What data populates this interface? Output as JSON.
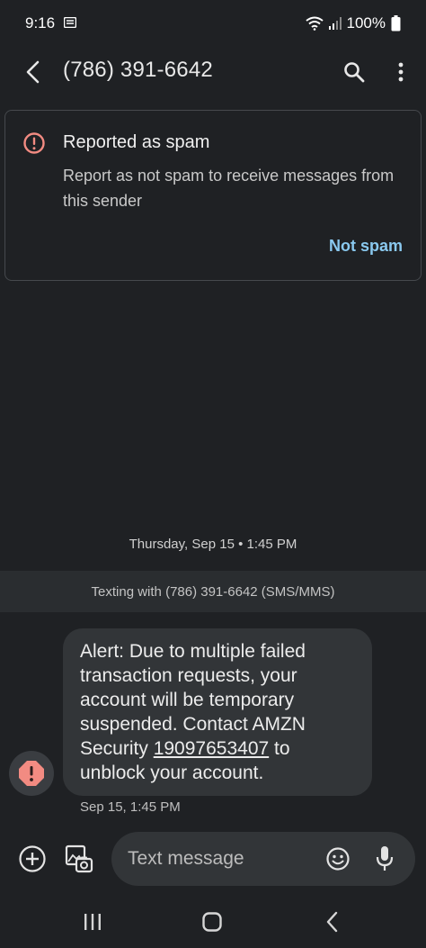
{
  "status_bar": {
    "time": "9:16",
    "battery": "100%",
    "icons": [
      "notification-icon",
      "wifi-icon",
      "signal-icon",
      "battery-icon"
    ]
  },
  "app_bar": {
    "title": "(786) 391-6642",
    "icons": [
      "back-arrow-icon",
      "search-icon",
      "more-vert-icon"
    ]
  },
  "spam_card": {
    "title": "Reported as spam",
    "description": "Report as not spam to receive messages from this sender",
    "action_label": "Not spam",
    "accent_color": "#8ac9ef",
    "warning_color": "#f28b82"
  },
  "conversation": {
    "date_separator": "Thursday, Sep 15 • 1:45 PM",
    "texting_with": "Texting with (786) 391-6642 (SMS/MMS)",
    "messages": [
      {
        "text_before_link": "Alert: Due to multiple failed transaction requests, your account will be temporary suspended. Contact AMZN Security ",
        "link": "19097653407",
        "text_after_link": " to unblock your account.",
        "timestamp": "Sep 15, 1:45 PM",
        "sender_icon": "spam-warning-icon"
      }
    ]
  },
  "compose": {
    "placeholder": "Text message",
    "icons": [
      "add-circle-icon",
      "gallery-icon",
      "emoji-icon",
      "mic-icon"
    ]
  },
  "nav_bar": {
    "icons": [
      "recents-icon",
      "home-icon",
      "back-icon"
    ]
  }
}
